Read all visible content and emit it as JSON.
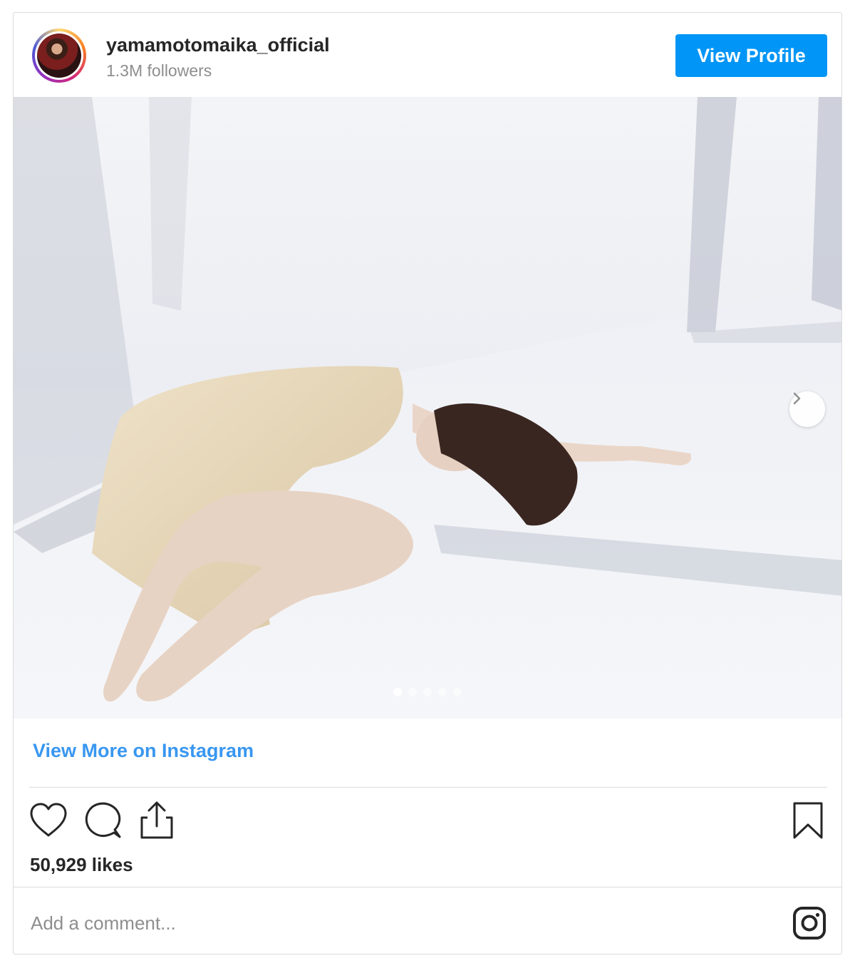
{
  "post": {
    "username": "yamamotomaika_official",
    "followers": "1.3M followers",
    "view_profile_label": "View Profile",
    "view_more_label": "View More on Instagram",
    "likes": "50,929 likes",
    "comment_placeholder": "Add a comment...",
    "carousel": {
      "slide_count": 5,
      "active_index": 0
    },
    "icons": {
      "like": "heart-icon",
      "comment": "comment-icon",
      "share": "share-icon",
      "save": "bookmark-icon",
      "brand": "instagram-icon",
      "next": "chevron-right-icon"
    },
    "colors": {
      "accent": "#0095f6",
      "link": "#3897f0",
      "muted": "#8e8e8e",
      "border": "#dbdbdb"
    }
  }
}
